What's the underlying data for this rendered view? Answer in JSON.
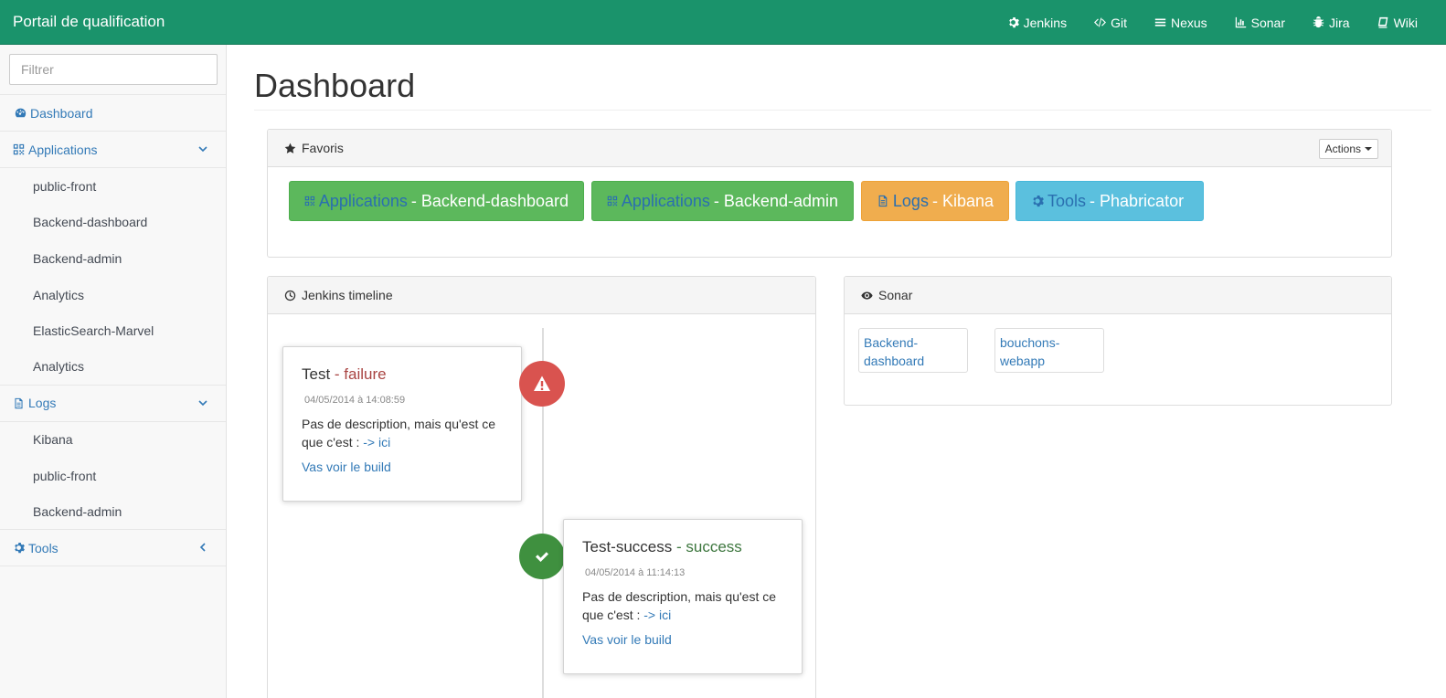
{
  "navbar": {
    "brand": "Portail de qualification",
    "links": [
      {
        "label": "Jenkins",
        "icon": "gear-icon"
      },
      {
        "label": "Git",
        "icon": "code-icon"
      },
      {
        "label": "Nexus",
        "icon": "bars-icon"
      },
      {
        "label": "Sonar",
        "icon": "bar-chart-icon"
      },
      {
        "label": "Jira",
        "icon": "bug-icon"
      },
      {
        "label": "Wiki",
        "icon": "book-icon"
      }
    ]
  },
  "sidebar": {
    "filter_placeholder": "Filtrer",
    "dashboard": "Dashboard",
    "applications": {
      "label": "Applications",
      "items": [
        "public-front",
        "Backend-dashboard",
        "Backend-admin",
        "Analytics",
        "ElasticSearch-Marvel",
        "Analytics"
      ]
    },
    "logs": {
      "label": "Logs",
      "items": [
        "Kibana",
        "public-front",
        "Backend-admin"
      ]
    },
    "tools": {
      "label": "Tools"
    }
  },
  "main": {
    "title": "Dashboard",
    "favoris": {
      "title": "Favoris",
      "actions_label": "Actions",
      "buttons": [
        {
          "category": "Applications",
          "name": " - Backend-dashboard",
          "color": "#5cb85c",
          "icon": "qrcode-icon"
        },
        {
          "category": "Applications",
          "name": " - Backend-admin",
          "color": "#5cb85c",
          "icon": "qrcode-icon"
        },
        {
          "category": "Logs",
          "name": " - Kibana",
          "color": "#f0ad4e",
          "icon": "file-icon"
        },
        {
          "category": "Tools",
          "name": " - Phabricator",
          "color": "#5bc0de",
          "icon": "gear-icon"
        }
      ]
    },
    "jenkins": {
      "title": "Jenkins timeline",
      "events": [
        {
          "job": "Test",
          "separator": " - ",
          "status": "failure",
          "date": "04/05/2014 à 14:08:59",
          "desc": "Pas de description, mais qu'est ce que c'est : ",
          "desc_link": "-> ici",
          "build_link": "Vas voir le build",
          "status_color": "#d9534f"
        },
        {
          "job": "Test-success",
          "separator": " - ",
          "status": "success",
          "date": "04/05/2014 à 11:14:13",
          "desc": "Pas de description, mais qu'est ce que c'est : ",
          "desc_link": "-> ici",
          "build_link": "Vas voir le build",
          "status_color": "#3f903f"
        }
      ]
    },
    "sonar": {
      "title": "Sonar",
      "projects": [
        "Backend-dashboard",
        "bouchons-webapp"
      ]
    }
  }
}
